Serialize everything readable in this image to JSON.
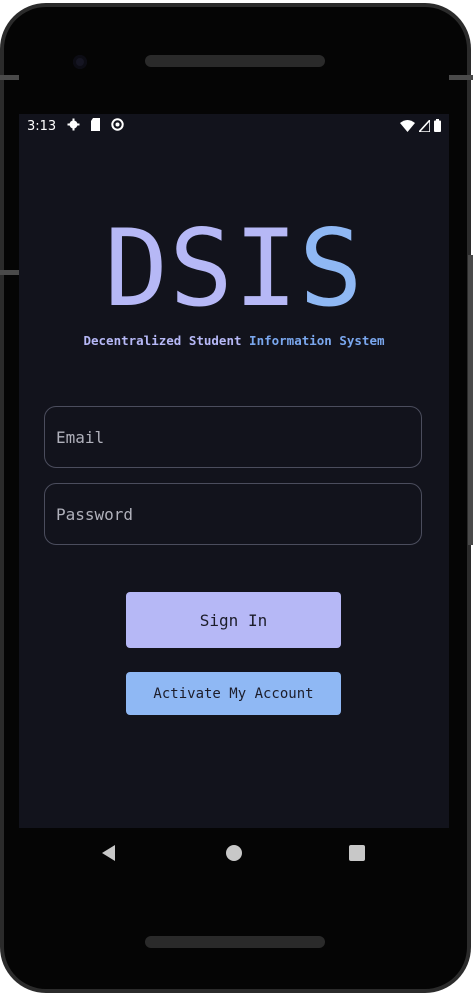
{
  "status_bar": {
    "time": "3:13",
    "left_icons": [
      "gear-icon",
      "sd-card-icon",
      "at-icon"
    ],
    "right_icons": [
      "wifi-icon",
      "signal-icon",
      "battery-icon"
    ]
  },
  "app": {
    "logo_part1": "DSI",
    "logo_part2": "S",
    "subtitle_part1": "Decentralized Student ",
    "subtitle_part2": "Information System"
  },
  "form": {
    "email_placeholder": "Email",
    "email_value": "",
    "password_placeholder": "Password",
    "password_value": ""
  },
  "buttons": {
    "sign_in": "Sign In",
    "activate": "Activate My Account"
  },
  "colors": {
    "background": "#12131c",
    "primary": "#b6b8f6",
    "secondary": "#8fb8f4"
  },
  "nav": {
    "icons": [
      "back-icon",
      "home-icon",
      "recents-icon"
    ]
  }
}
